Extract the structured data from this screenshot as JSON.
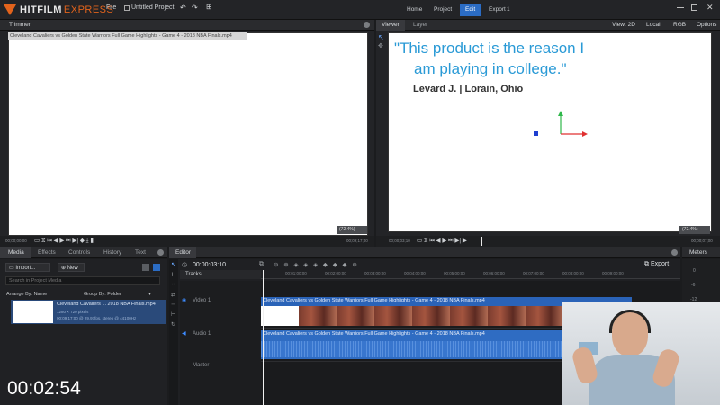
{
  "app": {
    "logo_primary": "HITFILM",
    "logo_secondary": "EXPRESS",
    "menu_file": "File",
    "project_name": "Untitled Project",
    "nav": [
      "Home",
      "Project",
      "Edit",
      "Export",
      "1"
    ],
    "nav_active": "Edit",
    "accent": "#2b6cc4",
    "brand": "#e2631c"
  },
  "trimmer": {
    "title": "Trimmer",
    "filename": "Cleveland Cavaliers vs Golden State Warriors Full Game Highlights - Game 4 - 2018 NBA Finals.mp4",
    "zoom": "(72.4%)",
    "tc_left": "00;00;00;00",
    "tc_right": "00;09;17;00"
  },
  "viewer": {
    "tabs": [
      "Viewer",
      "Layer"
    ],
    "view_select": "View: 2D",
    "local_select": "Local",
    "rgb_select": "RGB",
    "options": "Options",
    "quote_line1": "\"This product is the reason I",
    "quote_line2": "am playing in college.\"",
    "author": "Levard J. | Lorain, Ohio",
    "zoom": "(72.4%)",
    "tc_left": "00;00;03;10",
    "tc_right": "00;00;07;00"
  },
  "media": {
    "tabs": [
      "Media",
      "Effects",
      "Controls",
      "History",
      "Text"
    ],
    "import_label": "Import...",
    "new_label": "New",
    "search_placeholder": "Search in Project Media",
    "arrange_label": "Arrange By: Name",
    "group_label": "Group By: Folder",
    "item": {
      "name": "Cleveland Cavaliers ... 2018 NBA Finals.mp4",
      "line2": "1280 × 720 pixels",
      "line3": "00:09:17;00 @ 29.97fps, stereo @ 44100Hz"
    },
    "overlay_timer": "00:02:54"
  },
  "editor": {
    "title": "Editor",
    "timecode": "00:00:03:10",
    "export_label": "Export",
    "tracks_label": "Tracks",
    "video_track": "Video 1",
    "audio_track": "Audio 1",
    "master_track": "Master",
    "ruler": [
      "00:01:00:00",
      "00:02:00:00",
      "00:03:00:00",
      "00:04:00:00",
      "00:05:00:00",
      "00:06:00:00",
      "00:07:00:00",
      "00:08:00:00",
      "00:09:00:00"
    ],
    "clip_video_label": "Cleveland Cavaliers vs Golden State Warriors Full Game Highlights - Game 4 - 2018 NBA Finals.mp4",
    "clip_audio_label": "Cleveland Cavaliers vs Golden State Warriors Full Game Highlights - Game 4 - 2018 NBA Finals.mp4"
  },
  "meters": {
    "title": "Meters",
    "scale": [
      "0",
      "-6",
      "-12"
    ]
  }
}
